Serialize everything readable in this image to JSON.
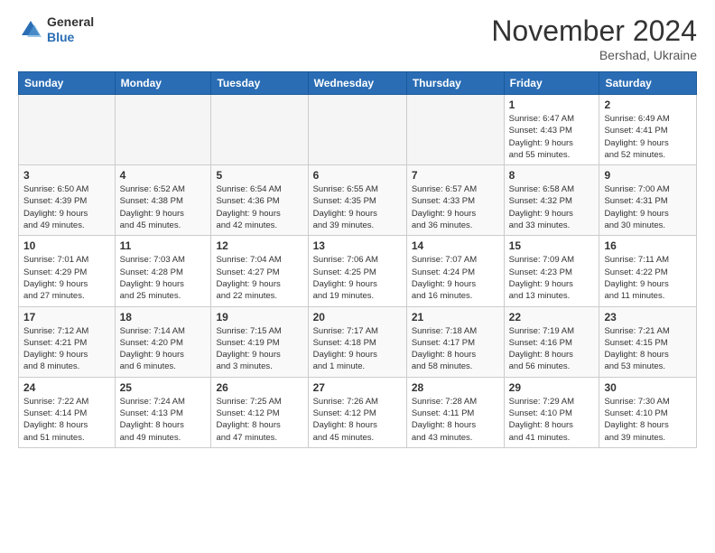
{
  "logo": {
    "general": "General",
    "blue": "Blue"
  },
  "title": "November 2024",
  "location": "Bershad, Ukraine",
  "days_header": [
    "Sunday",
    "Monday",
    "Tuesday",
    "Wednesday",
    "Thursday",
    "Friday",
    "Saturday"
  ],
  "weeks": [
    [
      {
        "day": "",
        "info": ""
      },
      {
        "day": "",
        "info": ""
      },
      {
        "day": "",
        "info": ""
      },
      {
        "day": "",
        "info": ""
      },
      {
        "day": "",
        "info": ""
      },
      {
        "day": "1",
        "info": "Sunrise: 6:47 AM\nSunset: 4:43 PM\nDaylight: 9 hours\nand 55 minutes."
      },
      {
        "day": "2",
        "info": "Sunrise: 6:49 AM\nSunset: 4:41 PM\nDaylight: 9 hours\nand 52 minutes."
      }
    ],
    [
      {
        "day": "3",
        "info": "Sunrise: 6:50 AM\nSunset: 4:39 PM\nDaylight: 9 hours\nand 49 minutes."
      },
      {
        "day": "4",
        "info": "Sunrise: 6:52 AM\nSunset: 4:38 PM\nDaylight: 9 hours\nand 45 minutes."
      },
      {
        "day": "5",
        "info": "Sunrise: 6:54 AM\nSunset: 4:36 PM\nDaylight: 9 hours\nand 42 minutes."
      },
      {
        "day": "6",
        "info": "Sunrise: 6:55 AM\nSunset: 4:35 PM\nDaylight: 9 hours\nand 39 minutes."
      },
      {
        "day": "7",
        "info": "Sunrise: 6:57 AM\nSunset: 4:33 PM\nDaylight: 9 hours\nand 36 minutes."
      },
      {
        "day": "8",
        "info": "Sunrise: 6:58 AM\nSunset: 4:32 PM\nDaylight: 9 hours\nand 33 minutes."
      },
      {
        "day": "9",
        "info": "Sunrise: 7:00 AM\nSunset: 4:31 PM\nDaylight: 9 hours\nand 30 minutes."
      }
    ],
    [
      {
        "day": "10",
        "info": "Sunrise: 7:01 AM\nSunset: 4:29 PM\nDaylight: 9 hours\nand 27 minutes."
      },
      {
        "day": "11",
        "info": "Sunrise: 7:03 AM\nSunset: 4:28 PM\nDaylight: 9 hours\nand 25 minutes."
      },
      {
        "day": "12",
        "info": "Sunrise: 7:04 AM\nSunset: 4:27 PM\nDaylight: 9 hours\nand 22 minutes."
      },
      {
        "day": "13",
        "info": "Sunrise: 7:06 AM\nSunset: 4:25 PM\nDaylight: 9 hours\nand 19 minutes."
      },
      {
        "day": "14",
        "info": "Sunrise: 7:07 AM\nSunset: 4:24 PM\nDaylight: 9 hours\nand 16 minutes."
      },
      {
        "day": "15",
        "info": "Sunrise: 7:09 AM\nSunset: 4:23 PM\nDaylight: 9 hours\nand 13 minutes."
      },
      {
        "day": "16",
        "info": "Sunrise: 7:11 AM\nSunset: 4:22 PM\nDaylight: 9 hours\nand 11 minutes."
      }
    ],
    [
      {
        "day": "17",
        "info": "Sunrise: 7:12 AM\nSunset: 4:21 PM\nDaylight: 9 hours\nand 8 minutes."
      },
      {
        "day": "18",
        "info": "Sunrise: 7:14 AM\nSunset: 4:20 PM\nDaylight: 9 hours\nand 6 minutes."
      },
      {
        "day": "19",
        "info": "Sunrise: 7:15 AM\nSunset: 4:19 PM\nDaylight: 9 hours\nand 3 minutes."
      },
      {
        "day": "20",
        "info": "Sunrise: 7:17 AM\nSunset: 4:18 PM\nDaylight: 9 hours\nand 1 minute."
      },
      {
        "day": "21",
        "info": "Sunrise: 7:18 AM\nSunset: 4:17 PM\nDaylight: 8 hours\nand 58 minutes."
      },
      {
        "day": "22",
        "info": "Sunrise: 7:19 AM\nSunset: 4:16 PM\nDaylight: 8 hours\nand 56 minutes."
      },
      {
        "day": "23",
        "info": "Sunrise: 7:21 AM\nSunset: 4:15 PM\nDaylight: 8 hours\nand 53 minutes."
      }
    ],
    [
      {
        "day": "24",
        "info": "Sunrise: 7:22 AM\nSunset: 4:14 PM\nDaylight: 8 hours\nand 51 minutes."
      },
      {
        "day": "25",
        "info": "Sunrise: 7:24 AM\nSunset: 4:13 PM\nDaylight: 8 hours\nand 49 minutes."
      },
      {
        "day": "26",
        "info": "Sunrise: 7:25 AM\nSunset: 4:12 PM\nDaylight: 8 hours\nand 47 minutes."
      },
      {
        "day": "27",
        "info": "Sunrise: 7:26 AM\nSunset: 4:12 PM\nDaylight: 8 hours\nand 45 minutes."
      },
      {
        "day": "28",
        "info": "Sunrise: 7:28 AM\nSunset: 4:11 PM\nDaylight: 8 hours\nand 43 minutes."
      },
      {
        "day": "29",
        "info": "Sunrise: 7:29 AM\nSunset: 4:10 PM\nDaylight: 8 hours\nand 41 minutes."
      },
      {
        "day": "30",
        "info": "Sunrise: 7:30 AM\nSunset: 4:10 PM\nDaylight: 8 hours\nand 39 minutes."
      }
    ]
  ]
}
